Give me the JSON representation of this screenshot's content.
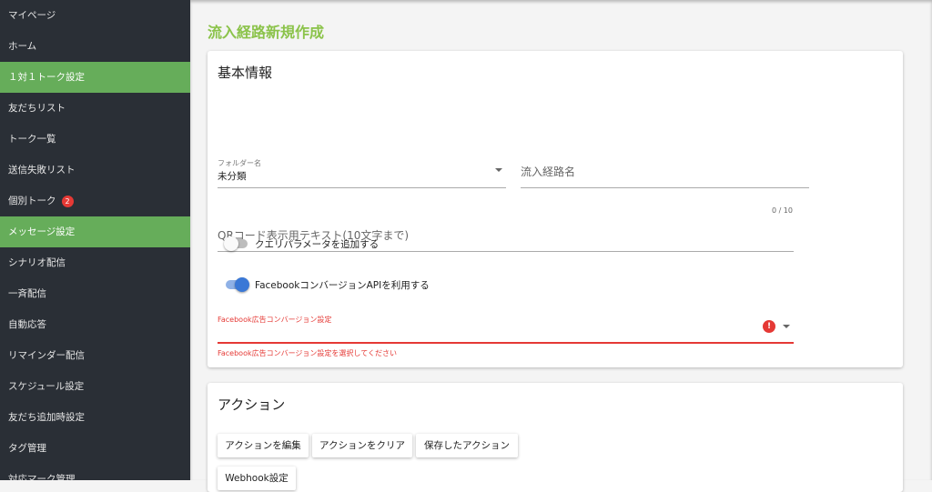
{
  "sidebar": {
    "items": [
      {
        "label": "マイページ"
      },
      {
        "label": "ホーム"
      },
      {
        "label": "１対１トーク設定",
        "active": true
      },
      {
        "label": "友だちリスト"
      },
      {
        "label": "トーク一覧"
      },
      {
        "label": "送信失敗リスト"
      },
      {
        "label": "個別トーク",
        "badge": "2"
      },
      {
        "label": "メッセージ設定",
        "active": true
      },
      {
        "label": "シナリオ配信"
      },
      {
        "label": "一斉配信"
      },
      {
        "label": "自動応答"
      },
      {
        "label": "リマインダー配信"
      },
      {
        "label": "スケジュール設定"
      },
      {
        "label": "友だち追加時設定"
      },
      {
        "label": "タグ管理"
      },
      {
        "label": "対応マーク管理"
      }
    ]
  },
  "page": {
    "title": "流入経路新規作成"
  },
  "basic": {
    "heading": "基本情報",
    "folder_label": "フォルダー名",
    "folder_value": "未分類",
    "route_name_placeholder": "流入経路名",
    "qr_placeholder": "QRコード表示用テキスト(10文字まで)",
    "qr_counter": "0 / 10",
    "query_toggle_label": "クエリパラメータを追加する",
    "query_toggle_on": false,
    "fb_toggle_label": "FacebookコンバージョンAPIを利用する",
    "fb_toggle_on": true,
    "fb_select_label": "Facebook広告コンバージョン設定",
    "fb_error": "Facebook広告コンバージョン設定を選択してください",
    "error_icon": "!"
  },
  "actions": {
    "heading": "アクション",
    "edit": "アクションを編集",
    "clear": "アクションをクリア",
    "saved": "保存したアクション",
    "webhook": "Webhook設定"
  },
  "colors": {
    "accent": "#8bc34a",
    "sidebar_active": "#66ad5a",
    "error": "#e53935",
    "toggle": "#3a78d6"
  }
}
